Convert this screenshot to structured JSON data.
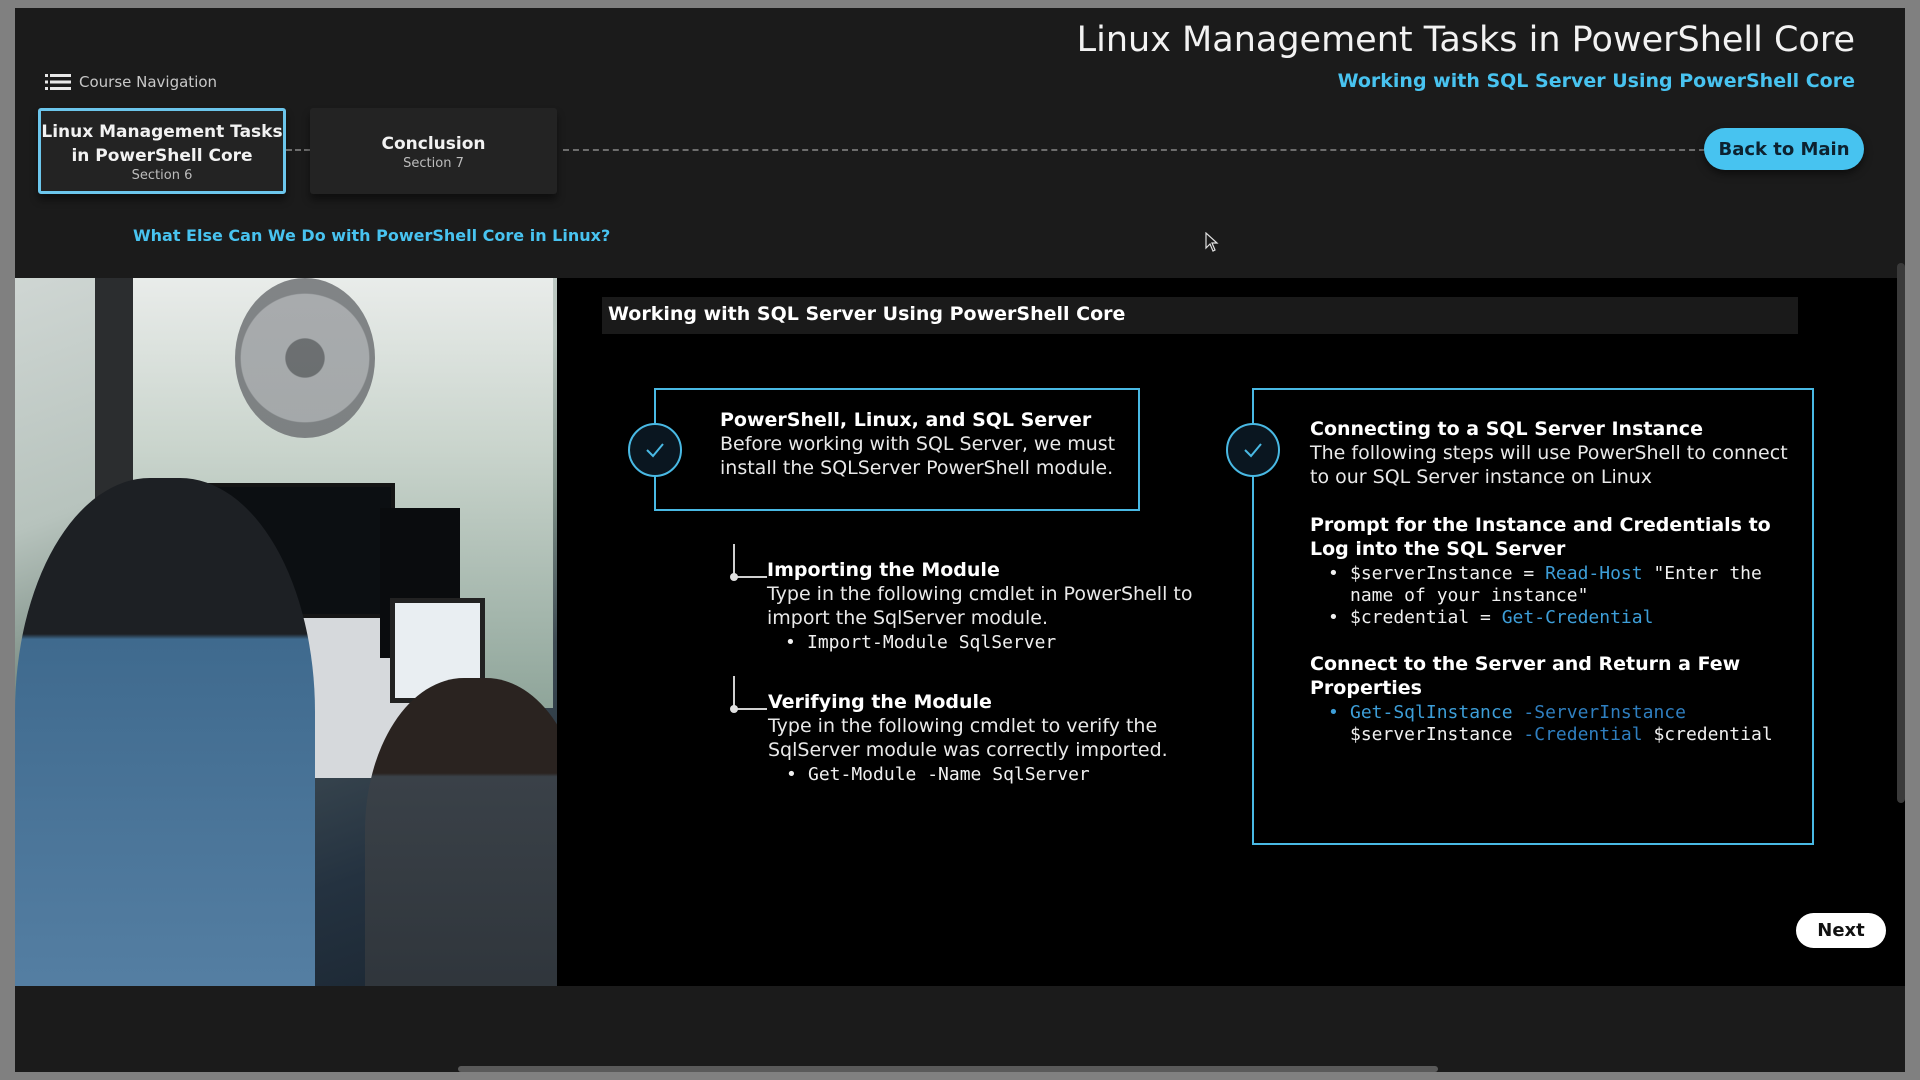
{
  "header": {
    "course_title": "Linux Management Tasks in PowerShell Core",
    "course_subtitle": "Working with SQL Server Using PowerShell Core",
    "nav_label": "Course Navigation",
    "back_button": "Back to Main"
  },
  "sections": [
    {
      "title": "Linux Management Tasks in PowerShell Core",
      "subtitle": "Section 6",
      "active": true
    },
    {
      "title": "Conclusion",
      "subtitle": "Section 7",
      "active": false
    }
  ],
  "sub_link": "What Else Can We Do with PowerShell Core in Linux?",
  "slide": {
    "title": "Working with SQL Server Using PowerShell Core",
    "left_box": {
      "heading": "PowerShell, Linux, and SQL Server",
      "body": "Before working with SQL Server, we must install the SQLServer PowerShell module."
    },
    "steps": [
      {
        "heading": "Importing the Module",
        "body": "Type in the following cmdlet in PowerShell to import the SqlServer module.",
        "code": "Import-Module SqlServer"
      },
      {
        "heading": "Verifying the Module",
        "body": "Type in the following cmdlet to verify the SqlServer module was correctly imported.",
        "code": "Get-Module -Name SqlServer"
      }
    ],
    "right_box": {
      "heading": "Connecting to a SQL Server Instance",
      "body": "The following steps will use PowerShell to connect to our SQL Server instance on Linux",
      "prompt_heading": "Prompt for the Instance and Credentials to Log into the SQL Server",
      "prompt_code_1a": "$serverInstance = ",
      "prompt_code_1b": "Read-Host",
      "prompt_code_1c": " \"Enter the name of your instance\"",
      "prompt_code_2a": "$credential = ",
      "prompt_code_2b": "Get-Credential",
      "connect_heading": "Connect to the Server and Return a Few Properties",
      "connect_code_a": "Get-SqlInstance",
      "connect_code_b": " -ServerInstance",
      "connect_code_c": " $serverInstance ",
      "connect_code_d": "-Credential",
      "connect_code_e": " $credential"
    },
    "next_button": "Next"
  },
  "colors": {
    "accent": "#48c3f0",
    "code_keyword": "#3d9ed8",
    "background": "#000000",
    "chrome": "#1b1b1b"
  },
  "icons": [
    "list-icon",
    "check-icon",
    "cursor-icon"
  ]
}
